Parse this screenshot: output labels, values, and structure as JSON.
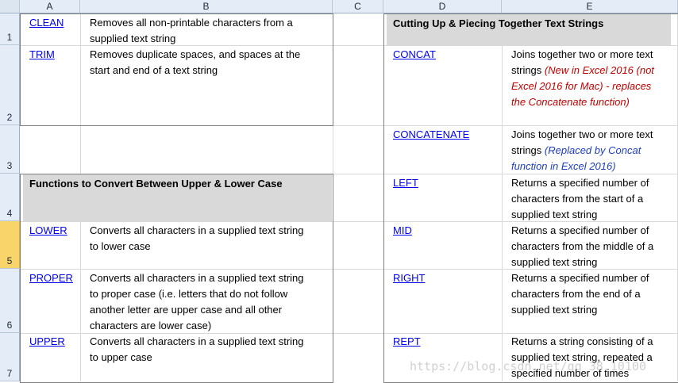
{
  "columns": [
    "A",
    "B",
    "C",
    "D",
    "E"
  ],
  "rows": [
    "1",
    "2",
    "3",
    "4",
    "5",
    "6",
    "7"
  ],
  "left": {
    "top_items": [
      {
        "name": "CLEAN",
        "desc": [
          "Removes all non-printable characters from a",
          "supplied text string"
        ]
      },
      {
        "name": "TRIM",
        "desc": [
          "Removes duplicate spaces, and spaces at the",
          "start and end of a text string"
        ]
      }
    ],
    "case_title": "Functions to Convert Between Upper & Lower Case",
    "case_items": [
      {
        "name": "LOWER",
        "desc": [
          "Converts all characters in a supplied text string",
          "to lower case"
        ]
      },
      {
        "name": "PROPER",
        "desc": [
          "Converts all characters in a supplied text string",
          "to proper case (i.e. letters that do not follow",
          "another letter are upper case and all other",
          "characters are lower case)"
        ]
      },
      {
        "name": "UPPER",
        "desc": [
          "Converts all characters in a supplied text string",
          "to upper case"
        ]
      }
    ]
  },
  "right": {
    "title": "Cutting Up & Piecing Together Text Strings",
    "concat": {
      "name": "CONCAT",
      "desc_1": "Joins together two or more text",
      "desc_2": "strings",
      "note_1": " (New in Excel 2016 (not",
      "note_2": "Excel 2016 for Mac) - replaces",
      "note_3": "the Concatenate function)"
    },
    "concatenate": {
      "name": "CONCATENATE",
      "desc_1": "Joins together two or more text",
      "desc_2": "strings",
      "note_1": " (Replaced by Concat",
      "note_2": "function in Excel 2016)"
    },
    "items": [
      {
        "name": "LEFT",
        "desc": [
          "Returns a specified number of",
          "characters from the start of a",
          "supplied text string"
        ]
      },
      {
        "name": "MID",
        "desc": [
          "Returns a specified number of",
          "characters from the middle of a",
          "supplied text string"
        ]
      },
      {
        "name": "RIGHT",
        "desc": [
          "Returns a specified number of",
          "characters from the end of a",
          "supplied text string"
        ]
      },
      {
        "name": "REPT",
        "desc": [
          "Returns a string consisting of a",
          "supplied text string, repeated a",
          "specified number of times"
        ]
      }
    ]
  },
  "watermark": "https://blog.csdn.net/qq_38.10100"
}
